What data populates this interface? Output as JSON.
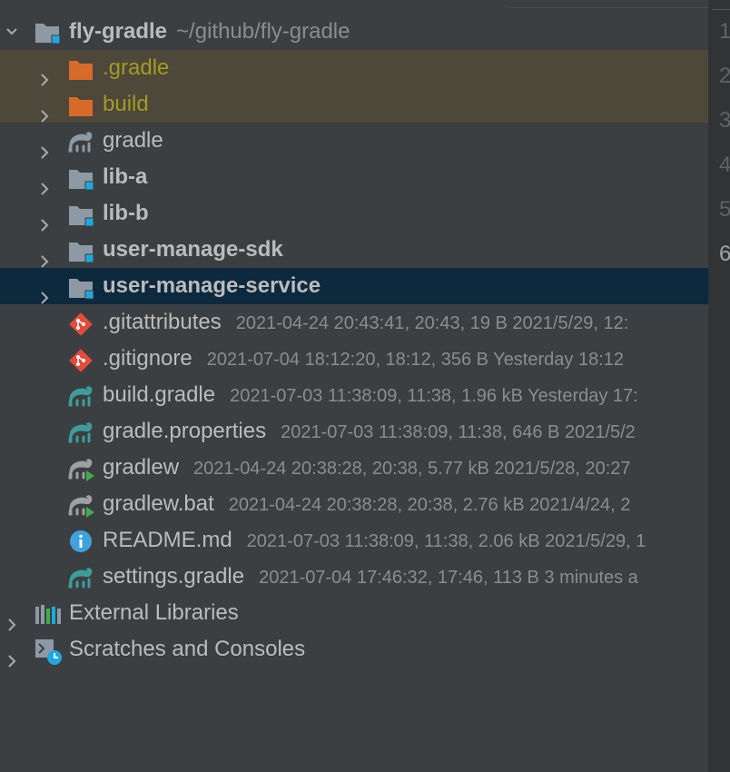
{
  "project": {
    "name": "fly-gradle",
    "path": "~/github/fly-gradle"
  },
  "folders": [
    {
      "label": ".gradle",
      "type": "excluded"
    },
    {
      "label": "build",
      "type": "excluded"
    },
    {
      "label": "gradle",
      "type": "gradle"
    },
    {
      "label": "lib-a",
      "type": "module"
    },
    {
      "label": "lib-b",
      "type": "module"
    },
    {
      "label": "user-manage-sdk",
      "type": "module"
    },
    {
      "label": "user-manage-service",
      "type": "module",
      "selected": true
    }
  ],
  "files": [
    {
      "label": ".gitattributes",
      "meta": "2021-04-24 20:43:41, 20:43, 19 B 2021/5/29, 12:",
      "icon": "git-icon"
    },
    {
      "label": ".gitignore",
      "meta": "2021-07-04 18:12:20, 18:12, 356 B Yesterday 18:12",
      "icon": "git-icon"
    },
    {
      "label": "build.gradle",
      "meta": "2021-07-03 11:38:09, 11:38, 1.96 kB Yesterday 17:",
      "icon": "gradle-icon"
    },
    {
      "label": "gradle.properties",
      "meta": "2021-07-03 11:38:09, 11:38, 646 B 2021/5/2",
      "icon": "gradle-icon"
    },
    {
      "label": "gradlew",
      "meta": "2021-04-24 20:38:28, 20:38, 5.77 kB 2021/5/28, 20:27",
      "icon": "gradlew-icon"
    },
    {
      "label": "gradlew.bat",
      "meta": "2021-04-24 20:38:28, 20:38, 2.76 kB 2021/4/24, 2",
      "icon": "gradlew-icon"
    },
    {
      "label": "README.md",
      "meta": "2021-07-03 11:38:09, 11:38, 2.06 kB 2021/5/29, 1",
      "icon": "info-icon"
    },
    {
      "label": "settings.gradle",
      "meta": "2021-07-04 17:46:32, 17:46, 113 B 3 minutes a",
      "icon": "gradle-icon"
    }
  ],
  "roots": [
    {
      "label": "External Libraries",
      "icon": "libraries-icon"
    },
    {
      "label": "Scratches and Consoles",
      "icon": "scratches-icon"
    }
  ],
  "line_numbers": [
    "1",
    "2",
    "3",
    "4",
    "5",
    "6"
  ],
  "colors": {
    "background": "#3c3f41",
    "selected_row": "#0d293e",
    "excluded_row": "#4d483a",
    "excluded_text": "#a39b23",
    "folder_orange": "#d86a2a",
    "folder_gray": "#8d9aa5",
    "module_badge": "#1fa8e0",
    "git_red": "#e44b3a",
    "gradle_teal": "#3c9e9b",
    "info_blue": "#3fa2dd"
  }
}
